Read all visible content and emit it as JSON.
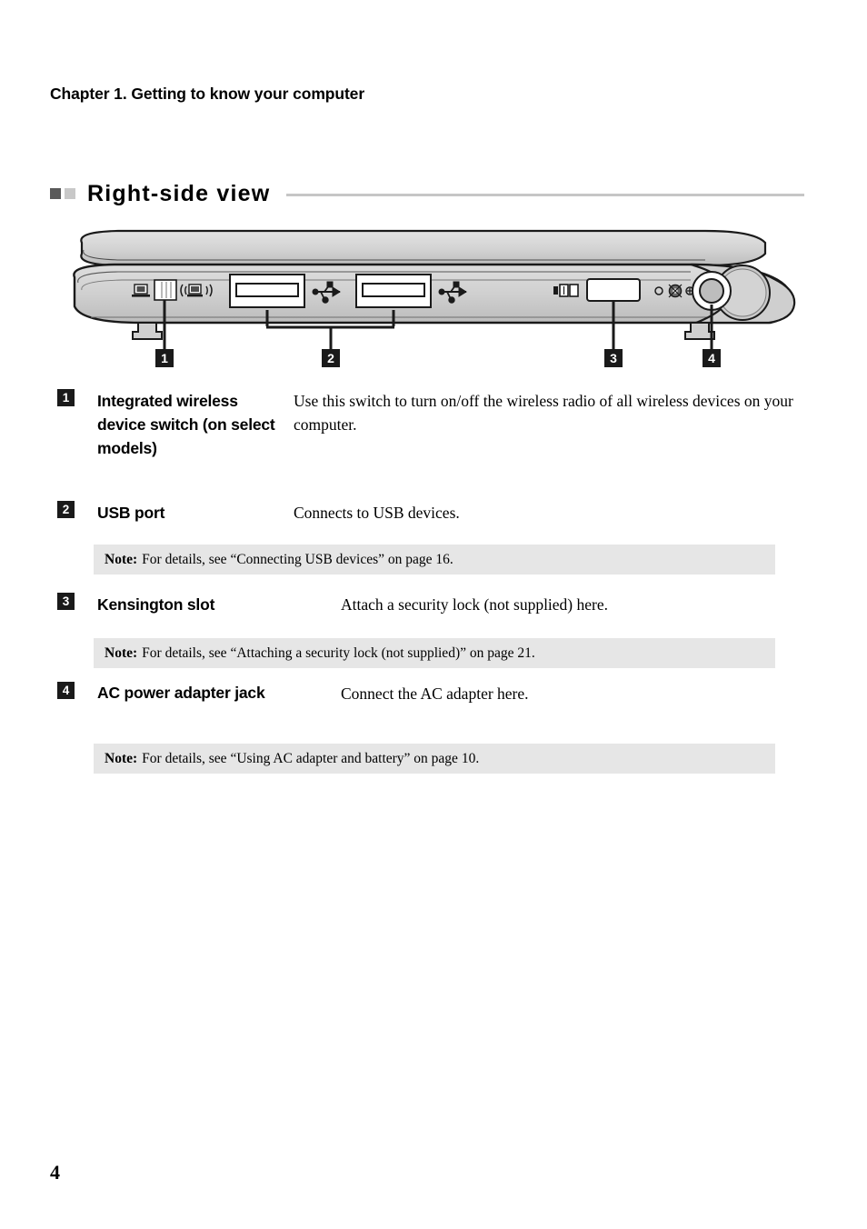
{
  "chapter_header": "Chapter 1. Getting to know your computer",
  "section": {
    "title": "Right-side view",
    "bullet_dark_color": "#595959",
    "bullet_light_color": "#c8c8c8",
    "rule_color": "#c6c6c6"
  },
  "figure": {
    "alt": "Right-side view of laptop showing ports",
    "callouts": [
      "1",
      "2",
      "3",
      "4"
    ],
    "port_icons": [
      "laptop-icon",
      "wireless-icon",
      "usb-icon",
      "usb-icon",
      "kensington-lock-icon",
      "dc-power-icon"
    ],
    "body_fill": "#d4d4d4",
    "lid_fill": "#cfcfcf",
    "outline_color": "#1a1a1a"
  },
  "items": [
    {
      "number": "1",
      "label": "Integrated wireless device switch (on select models)",
      "description": "Use this switch to turn on/off the wireless radio of all wireless devices on your computer.",
      "note": null
    },
    {
      "number": "2",
      "label": "USB port",
      "description": "Connects to USB devices.",
      "note": {
        "label": "Note:",
        "text": "For details, see “Connecting USB devices” on page 16."
      }
    },
    {
      "number": "3",
      "label": "Kensington slot",
      "description": "Attach a security lock (not supplied) here.",
      "note": {
        "label": "Note:",
        "text": "For details, see “Attaching a security lock (not supplied)” on page 21."
      }
    },
    {
      "number": "4",
      "label": "AC power adapter jack",
      "description": "Connect the AC adapter here.",
      "note": {
        "label": "Note:",
        "text": "For details, see “Using AC adapter and battery” on page 10."
      }
    }
  ],
  "page_number": "4"
}
